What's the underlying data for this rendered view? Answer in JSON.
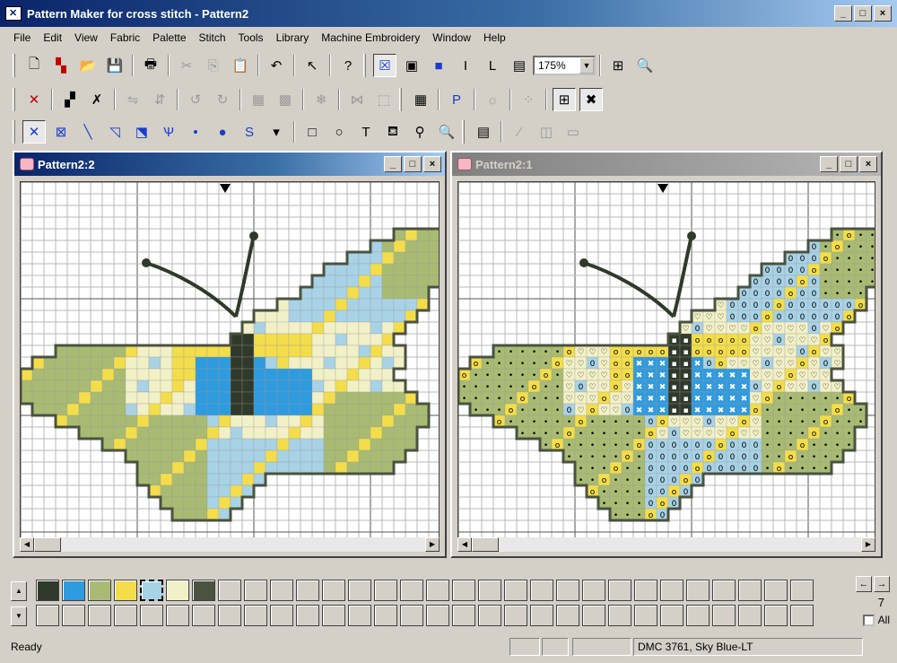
{
  "app": {
    "title": "Pattern Maker for cross stitch - Pattern2",
    "icon": "app-icon"
  },
  "window_buttons": {
    "minimize": "_",
    "maximize": "□",
    "close": "×"
  },
  "menu": [
    "File",
    "Edit",
    "View",
    "Fabric",
    "Palette",
    "Stitch",
    "Tools",
    "Library",
    "Machine Embroidery",
    "Window",
    "Help"
  ],
  "toolbar": {
    "zoom_value": "175%"
  },
  "windows": [
    {
      "title": "Pattern2:2",
      "active": true,
      "mode": "color-stitches"
    },
    {
      "title": "Pattern2:1",
      "active": false,
      "mode": "symbols"
    }
  ],
  "palette": {
    "colors": [
      "#2f3a2a",
      "#2f9bdf",
      "#a9bb72",
      "#f3dd4a",
      "#a8d2e6",
      "#f2f0c6",
      "#4a5240"
    ],
    "selected_index": 4,
    "slots_per_row": 30,
    "count": "7",
    "all_label": "All"
  },
  "status": {
    "text": "Ready",
    "color_info": "DMC  3761, Sky Blue-LT"
  }
}
